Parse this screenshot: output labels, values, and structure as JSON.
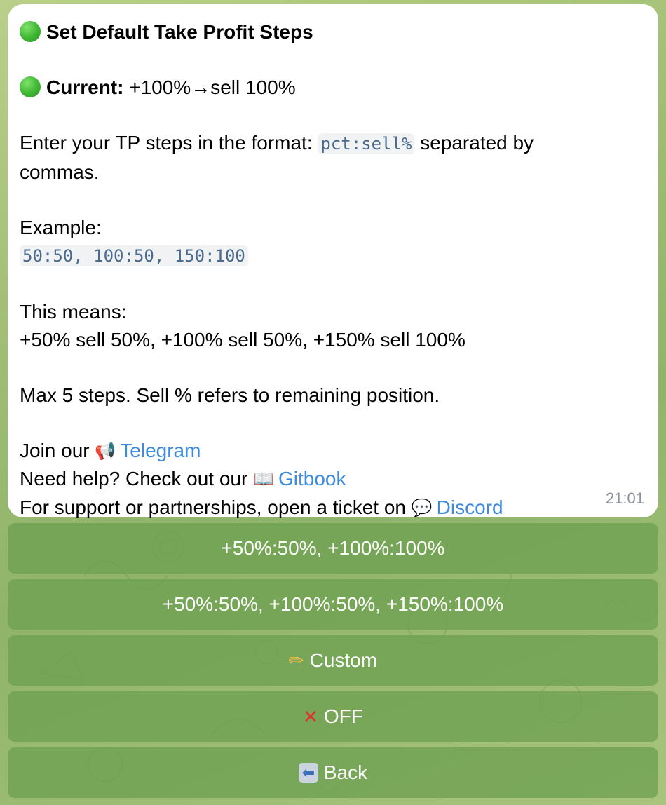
{
  "message": {
    "title": "Set Default Take Profit Steps",
    "current_label": "Current:",
    "current_value": " +100%→sell 100%",
    "format_prefix": "Enter your TP steps in the format: ",
    "format_code": "pct:sell%",
    "format_suffix": " separated by",
    "format_line2": "commas.",
    "example_label": "Example:",
    "example_code": "50:50, 100:50, 150:100",
    "means_label": "This means:",
    "means_text": "+50% sell 50%, +100% sell 50%, +150% sell 100%",
    "max_text": "Max 5 steps. Sell % refers to remaining position.",
    "join_prefix": "Join our ",
    "telegram_link": "Telegram",
    "help_prefix": "Need help? Check out our ",
    "gitbook_link": "Gitbook",
    "support_prefix": "For support or partnerships, open a ticket on ",
    "discord_link": "Discord",
    "time": "21:01"
  },
  "icons": {
    "status": "green-circle-icon",
    "telegram": "megaphone-icon",
    "gitbook": "open-book-icon",
    "discord": "speech-balloon-icon",
    "custom": "pencil-icon",
    "off": "cross-mark-icon",
    "back": "back-arrow-icon"
  },
  "keyboard": {
    "preset1": "+50%:50%, +100%:100%",
    "preset2": "+50%:50%, +100%:50%, +150%:100%",
    "custom": "Custom",
    "off": "OFF",
    "back": "Back"
  },
  "colors": {
    "link": "#3d8be0",
    "button": "#6ea052",
    "code": "#4a6b8e"
  }
}
